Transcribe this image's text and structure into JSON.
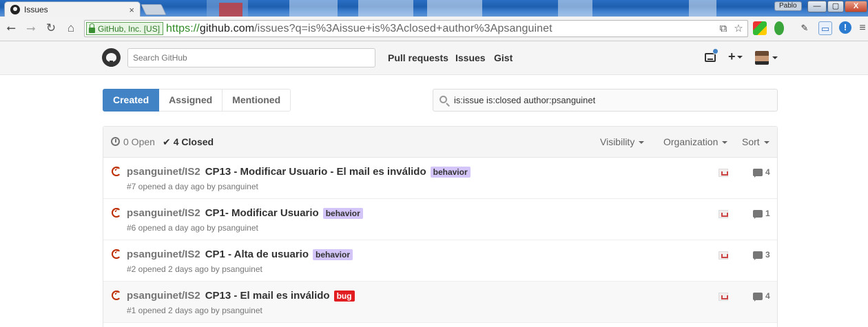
{
  "browser": {
    "tab_title": "Issues",
    "tab_close": "×",
    "user_badge": "Pablo",
    "win_minimize": "—",
    "win_maximize": "▢",
    "win_close": "X",
    "ev_identity": "GitHub, Inc. [US]",
    "url_scheme": "https://",
    "url_host": "github.com",
    "url_rest": "/issues?q=is%3Aissue+is%3Aclosed+author%3Apsanguinet"
  },
  "header": {
    "search_placeholder": "Search GitHub",
    "nav": [
      "Pull requests",
      "Issues",
      "Gist"
    ],
    "plus": "+"
  },
  "filters": {
    "tabs": [
      "Created",
      "Assigned",
      "Mentioned"
    ],
    "query": "is:issue is:closed author:psanguinet"
  },
  "list_header": {
    "open_label": "0 Open",
    "closed_label": "4 Closed",
    "visibility": "Visibility",
    "organization": "Organization",
    "sort": "Sort"
  },
  "issues": [
    {
      "repo": "psanguinet/IS2",
      "title": "CP13 - Modificar Usuario - El mail es inválido",
      "label": "behavior",
      "label_color": "#d4c5f9",
      "meta": "#7 opened a day ago by psanguinet",
      "comments": "4"
    },
    {
      "repo": "psanguinet/IS2",
      "title": "CP1- Modificar Usuario",
      "label": "behavior",
      "label_color": "#d4c5f9",
      "meta": "#6 opened a day ago by psanguinet",
      "comments": "1"
    },
    {
      "repo": "psanguinet/IS2",
      "title": "CP1 - Alta de usuario",
      "label": "behavior",
      "label_color": "#d4c5f9",
      "meta": "#2 opened 2 days ago by psanguinet",
      "comments": "3"
    },
    {
      "repo": "psanguinet/IS2",
      "title": "CP13 - El mail es inválido",
      "label": "bug",
      "label_color": "#e11d21",
      "meta": "#1 opened 2 days ago by psanguinet",
      "comments": "4"
    }
  ],
  "colors": {
    "accent": "#4183c4",
    "closed_icon": "#bd2c00"
  }
}
